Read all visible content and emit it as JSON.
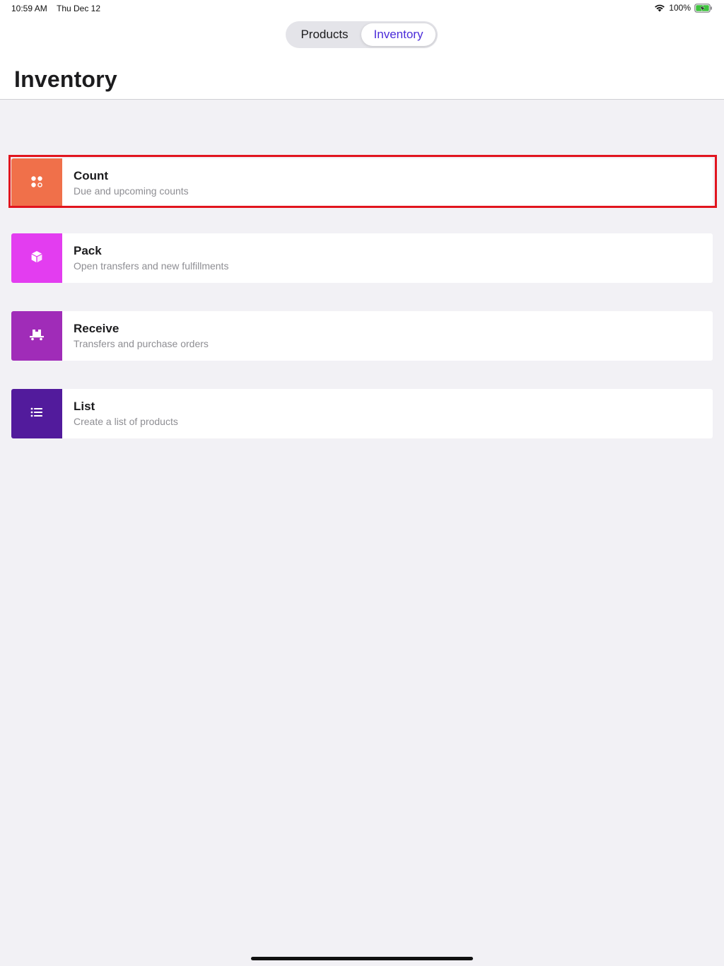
{
  "status_bar": {
    "time": "10:59 AM",
    "date": "Thu Dec 12",
    "battery": "100%"
  },
  "segmented": {
    "products_label": "Products",
    "inventory_label": "Inventory",
    "selected": "Inventory"
  },
  "page": {
    "title": "Inventory"
  },
  "items": [
    {
      "title": "Count",
      "subtitle": "Due and upcoming counts",
      "color": "#f0704a",
      "icon": "count-icon"
    },
    {
      "title": "Pack",
      "subtitle": "Open transfers and new fulfillments",
      "color": "#e33df0",
      "icon": "box-icon"
    },
    {
      "title": "Receive",
      "subtitle": "Transfers and purchase orders",
      "color": "#a02cb8",
      "icon": "cart-icon"
    },
    {
      "title": "List",
      "subtitle": "Create a list of products",
      "color": "#521b9c",
      "icon": "list-icon"
    }
  ],
  "colors": {
    "accent": "#4a2bd9",
    "highlight": "#e1141e",
    "background": "#f2f1f5"
  }
}
